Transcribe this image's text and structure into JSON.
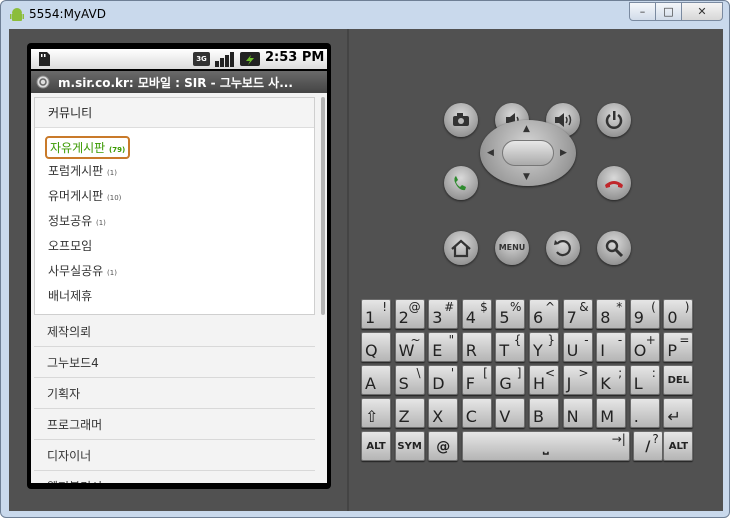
{
  "window": {
    "title": "5554:MyAVD",
    "min_glyph": "–",
    "max_glyph": "□",
    "close_glyph": "✕"
  },
  "statusbar": {
    "network": "3G",
    "time": "2:53 PM"
  },
  "browser": {
    "url_title": "m.sir.co.kr: 모바일 : SIR - 그누보드 사..."
  },
  "menu": {
    "header": "커뮤니티",
    "items": [
      {
        "label": "자유게시판",
        "count": "(79)"
      },
      {
        "label": "포럼게시판",
        "count": "(1)"
      },
      {
        "label": "유머게시판",
        "count": "(10)"
      },
      {
        "label": "정보공유",
        "count": "(1)"
      },
      {
        "label": "오프모임",
        "count": ""
      },
      {
        "label": "사무실공유",
        "count": "(1)"
      },
      {
        "label": "배너제휴",
        "count": ""
      }
    ]
  },
  "groups": [
    "제작의뢰",
    "그누보드4",
    "기획자",
    "프로그래머",
    "디자이너",
    "웹퍼블리셔"
  ],
  "controls": {
    "menu_label": "MENU"
  },
  "keyboard": {
    "row1": [
      {
        "m": "1",
        "a": "!"
      },
      {
        "m": "2",
        "a": "@"
      },
      {
        "m": "3",
        "a": "#"
      },
      {
        "m": "4",
        "a": "$"
      },
      {
        "m": "5",
        "a": "%"
      },
      {
        "m": "6",
        "a": "^"
      },
      {
        "m": "7",
        "a": "&"
      },
      {
        "m": "8",
        "a": "*"
      },
      {
        "m": "9",
        "a": "("
      },
      {
        "m": "0",
        "a": ")"
      }
    ],
    "row2": [
      {
        "m": "Q",
        "a": ""
      },
      {
        "m": "W",
        "a": "~"
      },
      {
        "m": "E",
        "a": "\""
      },
      {
        "m": "R",
        "a": ""
      },
      {
        "m": "T",
        "a": "{"
      },
      {
        "m": "Y",
        "a": "}"
      },
      {
        "m": "U",
        "a": "-"
      },
      {
        "m": "I",
        "a": "-"
      },
      {
        "m": "O",
        "a": "+"
      },
      {
        "m": "P",
        "a": "="
      }
    ],
    "row3": [
      {
        "m": "A",
        "a": ""
      },
      {
        "m": "S",
        "a": "\\"
      },
      {
        "m": "D",
        "a": "'"
      },
      {
        "m": "F",
        "a": "["
      },
      {
        "m": "G",
        "a": "]"
      },
      {
        "m": "H",
        "a": "<"
      },
      {
        "m": "J",
        "a": ">"
      },
      {
        "m": "K",
        "a": ";"
      },
      {
        "m": "L",
        "a": ":"
      },
      {
        "m": "DEL",
        "a": ""
      }
    ],
    "row4": [
      {
        "m": "⇧",
        "a": ""
      },
      {
        "m": "Z",
        "a": ""
      },
      {
        "m": "X",
        "a": ""
      },
      {
        "m": "C",
        "a": ""
      },
      {
        "m": "V",
        "a": ""
      },
      {
        "m": "B",
        "a": ""
      },
      {
        "m": "N",
        "a": ""
      },
      {
        "m": "M",
        "a": ""
      },
      {
        "m": ".",
        "a": ""
      },
      {
        "m": "↵",
        "a": ""
      }
    ],
    "row5": {
      "alt_left": "ALT",
      "sym": "SYM",
      "at": "@",
      "space": "⎵",
      "tab_mark": "→|",
      "slash": "/",
      "question": "?",
      "comma": ",",
      "alt_right": "ALT"
    }
  },
  "colors": {
    "window_frame": "#c9d9ec",
    "emulator_bg": "#515151",
    "active_item": "#3a9a00",
    "highlight_box": "#c97a2a"
  }
}
